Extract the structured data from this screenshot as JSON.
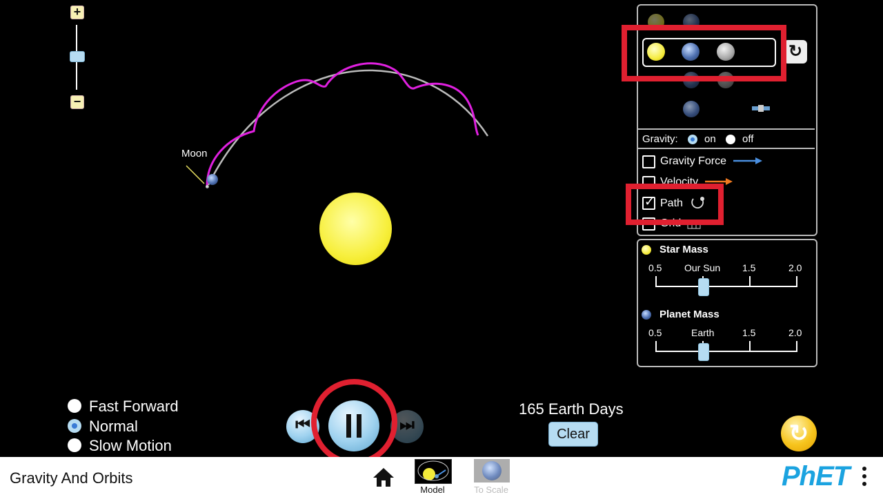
{
  "stage": {
    "moon_label": "Moon"
  },
  "bodies_panel": {
    "gravity_label": "Gravity:",
    "gravity_on": "on",
    "gravity_off": "off",
    "gravity_value": "on",
    "checkboxes": [
      {
        "label": "Gravity Force",
        "checked": false,
        "arrow_color": "#4a8fe0"
      },
      {
        "label": "Velocity",
        "checked": false,
        "arrow_color": "#f07a20"
      },
      {
        "label": "Path",
        "checked": true
      },
      {
        "label": "Grid",
        "checked": false
      }
    ]
  },
  "mass_panel": {
    "star_title": "Star Mass",
    "star_ticks": [
      "0.5",
      "Our Sun",
      "1.5",
      "2.0"
    ],
    "star_value": 1.0,
    "planet_title": "Planet Mass",
    "planet_ticks": [
      "0.5",
      "Earth",
      "1.5",
      "2.0"
    ],
    "planet_value": 1.0
  },
  "speed": {
    "options": [
      "Fast Forward",
      "Normal",
      "Slow Motion"
    ],
    "selected": "Normal"
  },
  "time": {
    "elapsed": "165 Earth Days",
    "clear_label": "Clear"
  },
  "bottom_bar": {
    "title": "Gravity And Orbits",
    "screens": [
      "Model",
      "To Scale"
    ],
    "logo": "PhET"
  },
  "colors": {
    "path_planet": "#e020e0",
    "path_moon": "#bbbbbb",
    "highlight": "#e02030"
  }
}
